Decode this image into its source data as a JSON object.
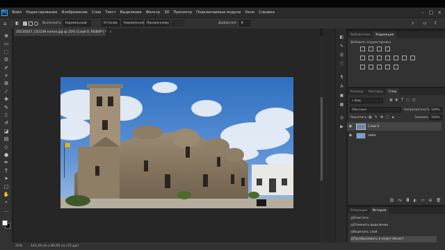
{
  "app": {
    "logo": "Ps"
  },
  "menu": [
    "Файл",
    "Редактирование",
    "Изображение",
    "Слои",
    "Текст",
    "Выделение",
    "Фильтр",
    "3D",
    "Просмотр",
    "Подключаемые модули",
    "Окно",
    "Справка"
  ],
  "options": {
    "mode_label": "Выполнить",
    "mode_value": "Нормальный",
    "style_buttons": [
      "Установ.",
      "Нормальная",
      "Прозрачному"
    ],
    "diffusion_label": "Диффузия:",
    "diffusion_value": "8"
  },
  "document": {
    "tab_title": "20230507_132149 копия.jpg @ 25% (Слой 0, RGB/8*) *"
  },
  "status": {
    "zoom": "25%",
    "dims": "142,29 см x 80,00 см (72 ppi)"
  },
  "libraries_panel": {
    "tabs": [
      "Библиотеки",
      "Коррекция"
    ],
    "active_tab": "Коррекция",
    "add_label": "Добавить корректировку"
  },
  "layers_panel": {
    "tabs": [
      "Каналы",
      "Контуры",
      "Слои"
    ],
    "active_tab": "Слои",
    "filter_label": "Вид",
    "blend_mode": "Обычные",
    "opacity_label": "Непрозрачность:",
    "opacity_value": "100%",
    "lock_label": "Закрепить:",
    "fill_label": "Заливка:",
    "fill_value": "100%",
    "layers": [
      {
        "name": "Слой 0"
      },
      {
        "name": "либа"
      }
    ]
  },
  "history_panel": {
    "tabs": [
      "Операции",
      "История"
    ],
    "active_tab": "История",
    "items": [
      "Очистить",
      "Отменить выделение",
      "Вырезать слой",
      "Преобразовать в смарт-объект"
    ]
  },
  "colors": {
    "accent": "#31a8ff",
    "panel_bg": "#323232",
    "canvas_bg": "#262626"
  }
}
